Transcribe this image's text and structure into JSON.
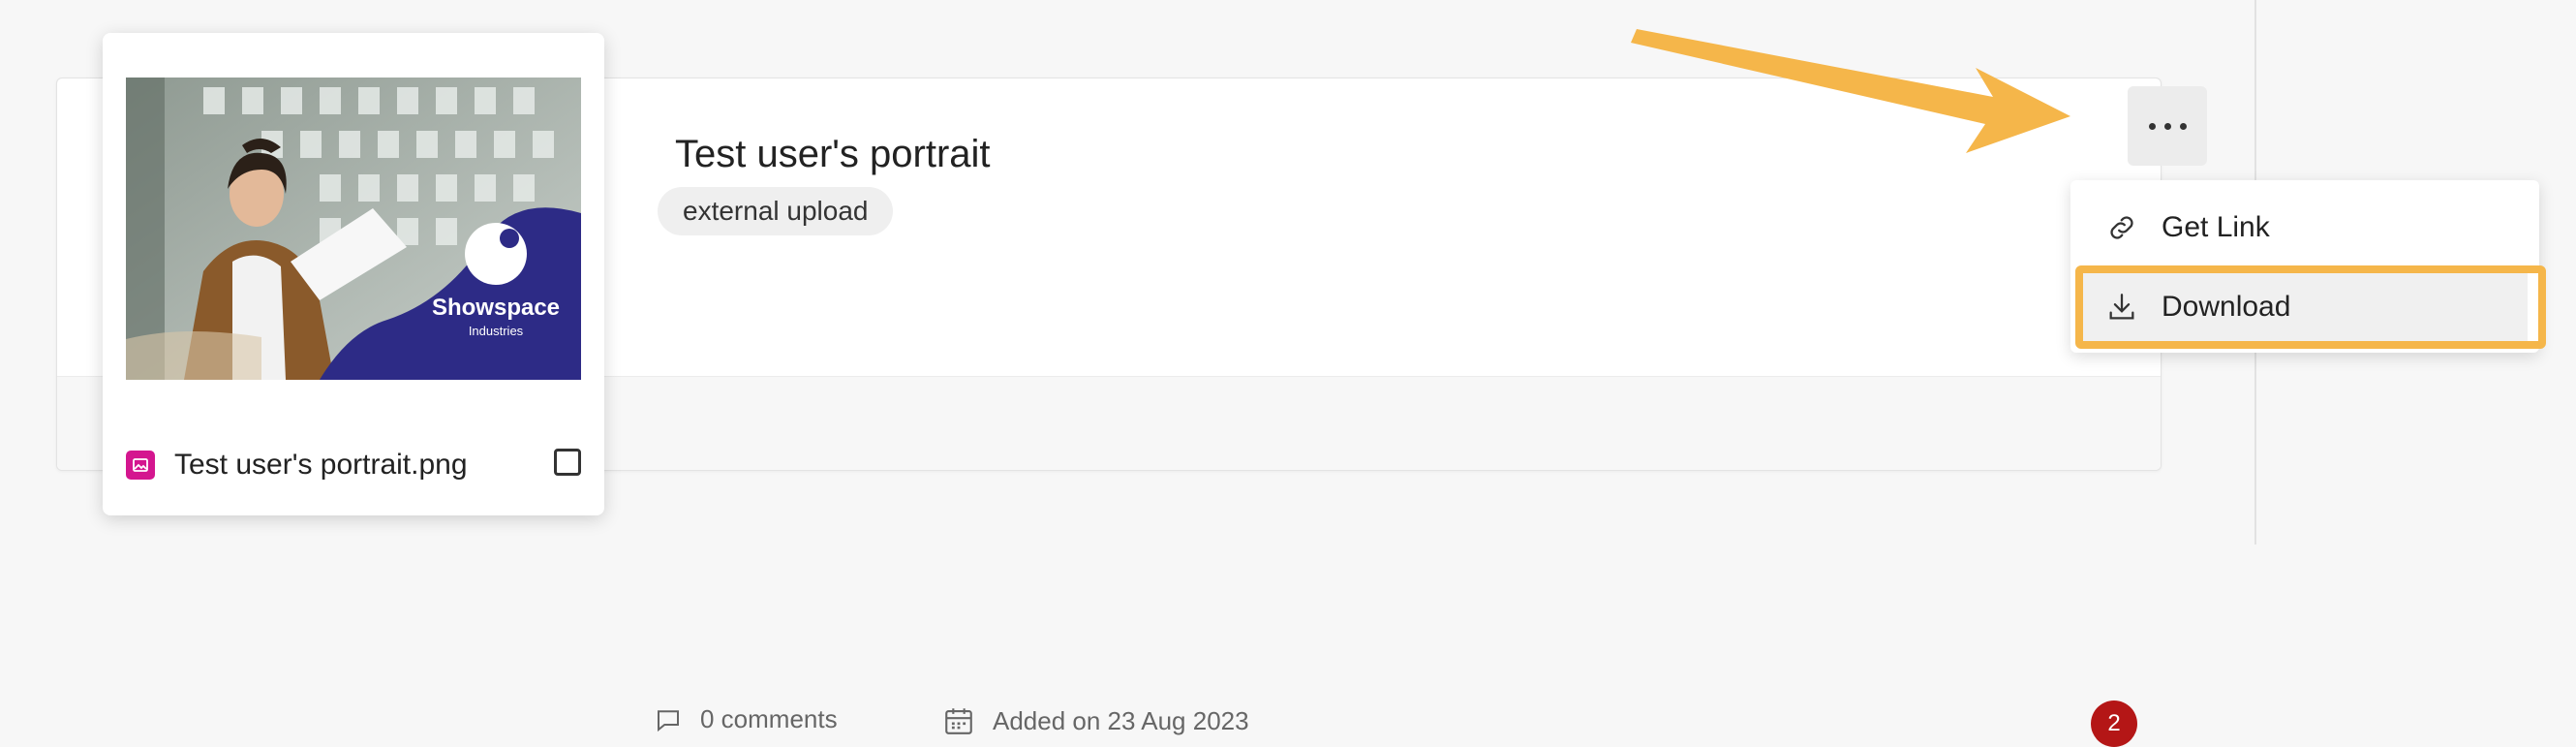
{
  "asset": {
    "title": "Test user's portrait",
    "tag": "external upload",
    "comments": "0 comments",
    "added": "Added on 23 Aug 2023",
    "badge_count": "2"
  },
  "thumbnail": {
    "file_name": "Test user's portrait.png",
    "brand": "Showspace",
    "brand_sub": "Industries"
  },
  "menu": {
    "items": [
      {
        "label": "Get Link",
        "icon": "link-icon"
      },
      {
        "label": "Download",
        "icon": "download-icon"
      }
    ]
  },
  "colors": {
    "annotation": "#f5b64a",
    "badge": "#b41616",
    "brand_navy": "#2d2b86",
    "file_icon": "#d4168f"
  }
}
